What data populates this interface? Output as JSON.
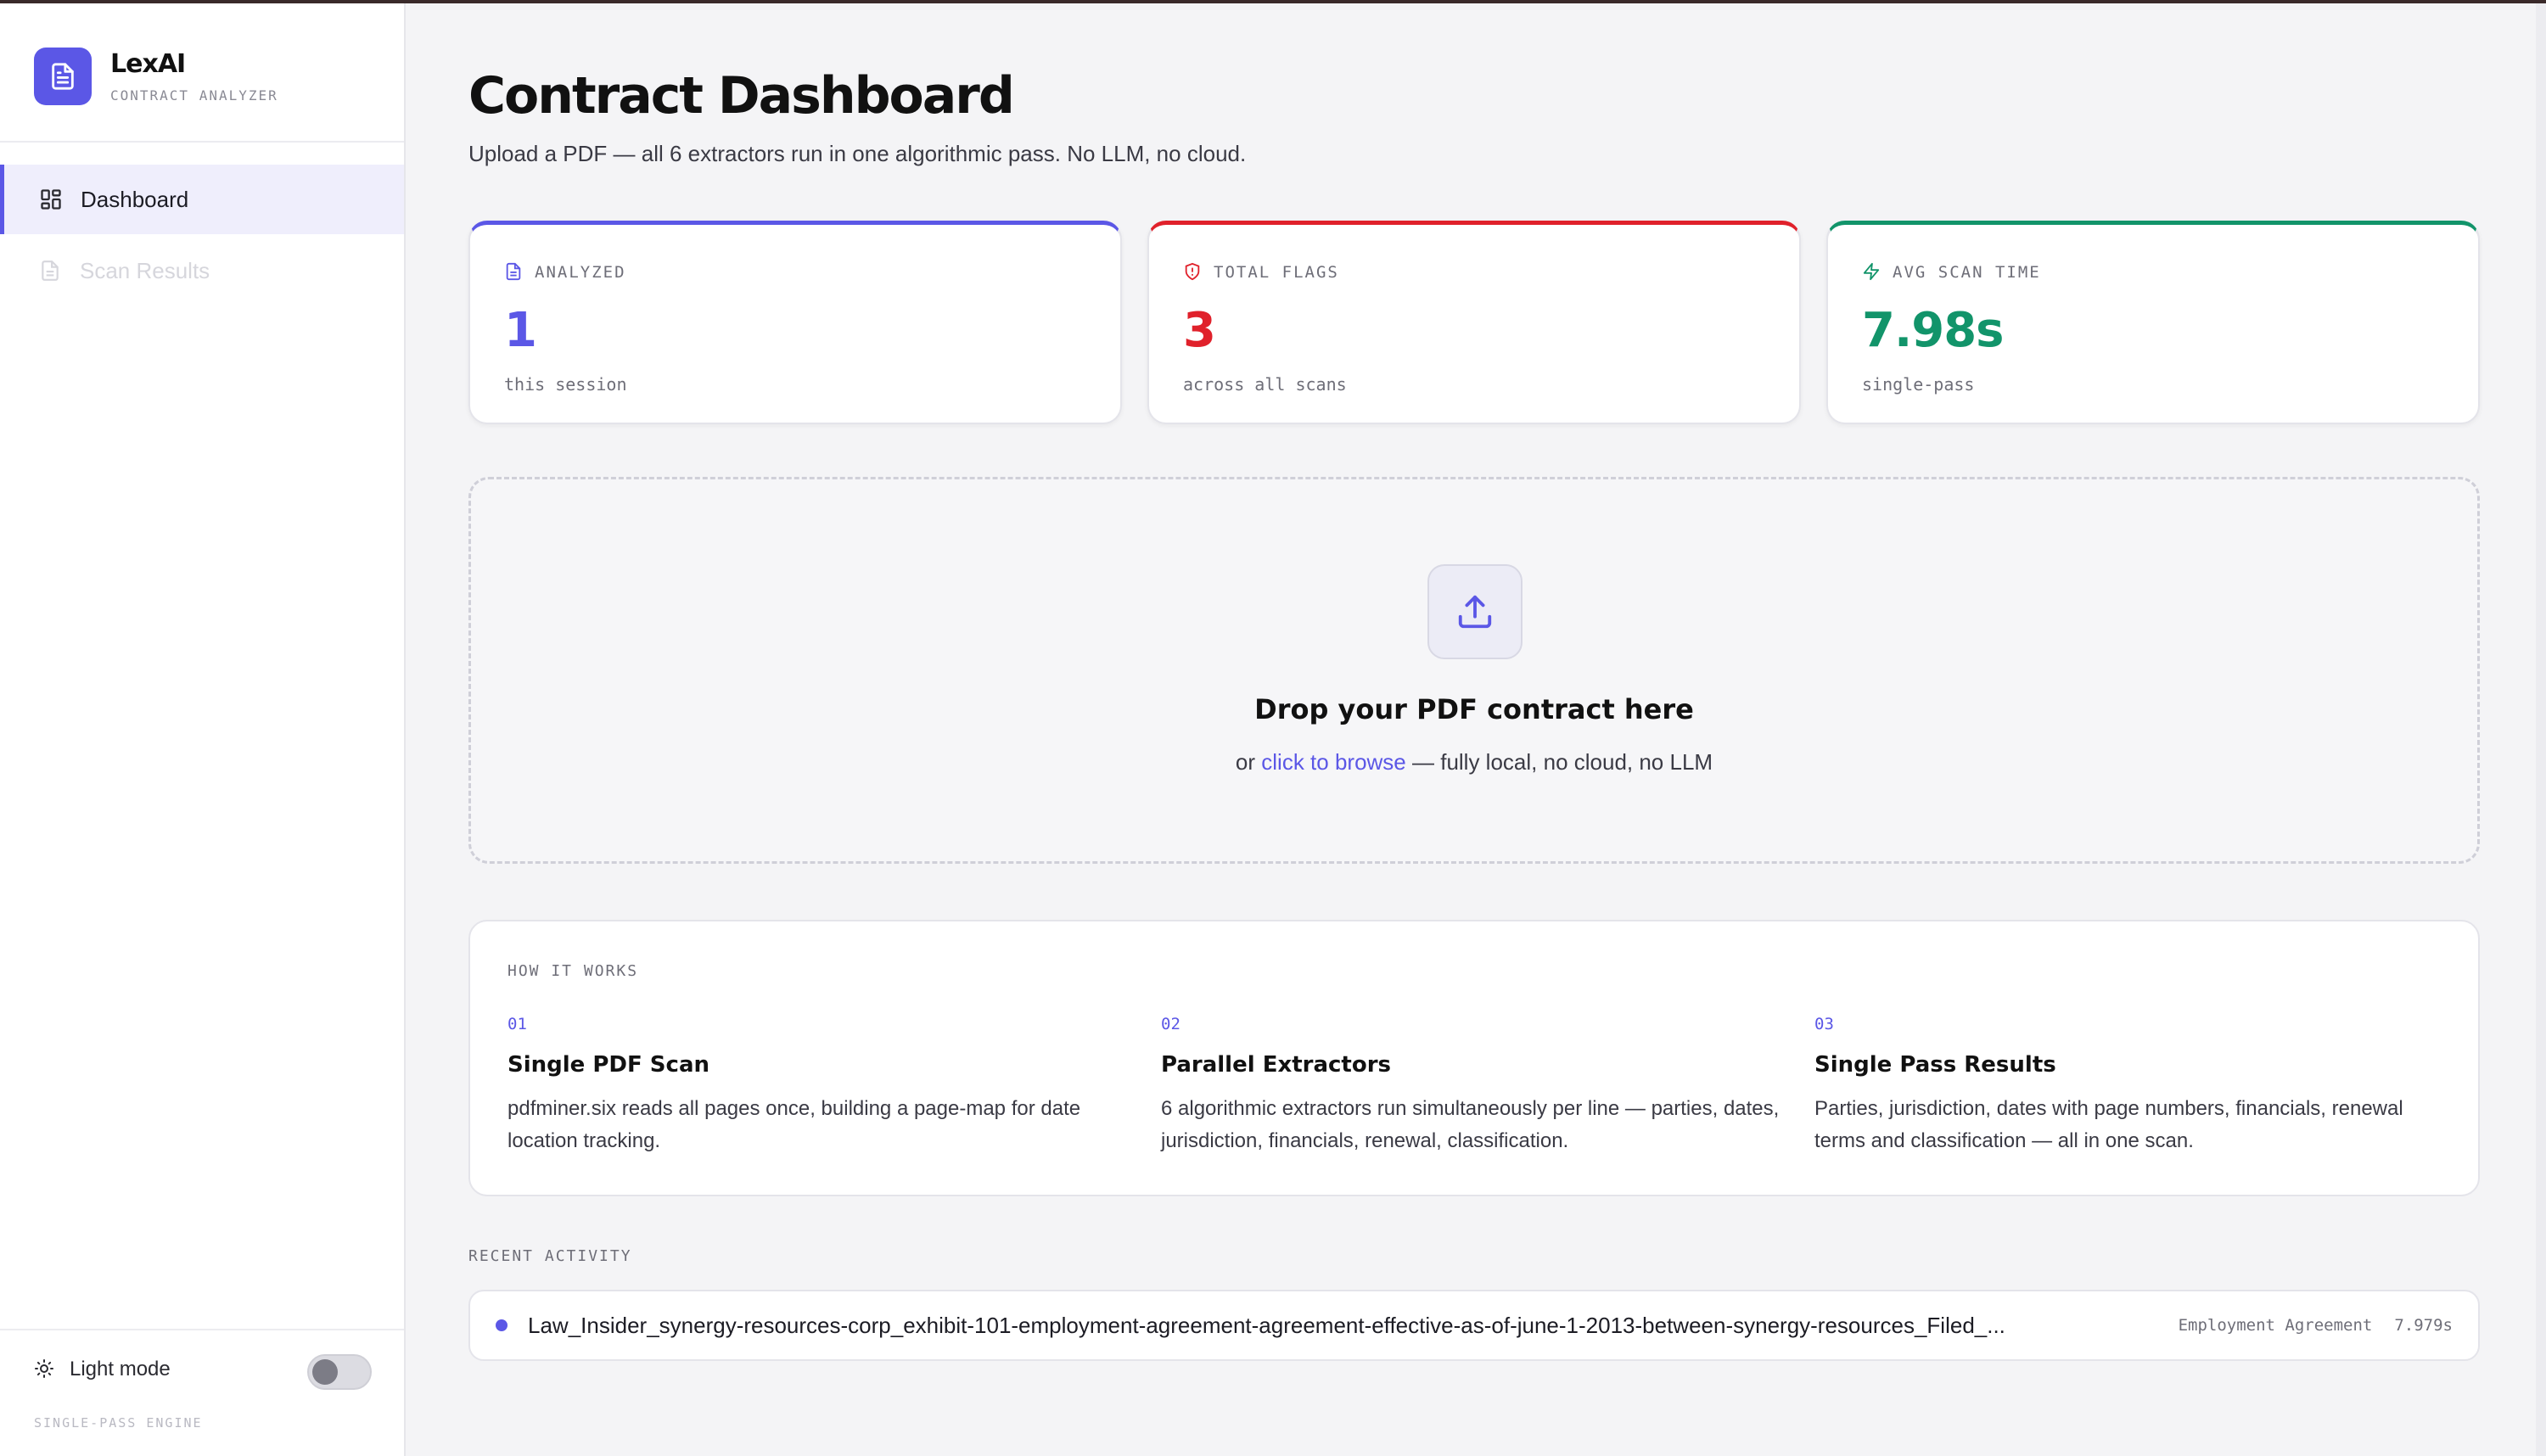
{
  "brand": {
    "name": "LexAI",
    "subtitle": "CONTRACT ANALYZER"
  },
  "sidebar": {
    "items": [
      {
        "label": "Dashboard",
        "icon": "grid-icon",
        "active": true
      },
      {
        "label": "Scan Results",
        "icon": "document-icon",
        "disabled": true
      }
    ],
    "theme_label": "Light mode",
    "theme_toggle_on": false,
    "engine_label": "SINGLE-PASS ENGINE"
  },
  "header": {
    "title": "Contract Dashboard",
    "subtitle": "Upload a PDF — all 6 extractors run in one algorithmic pass. No LLM, no cloud."
  },
  "stats": [
    {
      "label": "ANALYZED",
      "value": "1",
      "note": "this session",
      "icon": "document-icon",
      "color": "#5b57e6"
    },
    {
      "label": "TOTAL FLAGS",
      "value": "3",
      "note": "across all scans",
      "icon": "shield-alert-icon",
      "color": "#e0212b"
    },
    {
      "label": "AVG SCAN TIME",
      "value": "7.98s",
      "note": "single-pass",
      "icon": "lightning-icon",
      "color": "#12946a"
    }
  ],
  "dropzone": {
    "title": "Drop your PDF contract here",
    "prefix": "or",
    "link": "click to browse",
    "suffix": "— fully local, no cloud, no LLM"
  },
  "how_it_works": {
    "heading": "HOW IT WORKS",
    "steps": [
      {
        "num": "01",
        "title": "Single PDF Scan",
        "body": "pdfminer.six reads all pages once, building a page-map for date location tracking."
      },
      {
        "num": "02",
        "title": "Parallel Extractors",
        "body": "6 algorithmic extractors run simultaneously per line — parties, dates, jurisdiction, financials, renewal, classification."
      },
      {
        "num": "03",
        "title": "Single Pass Results",
        "body": "Parties, jurisdiction, dates with page numbers, financials, renewal terms and classification — all in one scan."
      }
    ]
  },
  "recent": {
    "heading": "RECENT ACTIVITY",
    "items": [
      {
        "file": "Law_Insider_synergy-resources-corp_exhibit-101-employment-agreement-agreement-effective-as-of-june-1-2013-between-synergy-resources_Filed_...",
        "type": "Employment Agreement",
        "time": "7.979s"
      }
    ]
  },
  "accent": "#5b57e6"
}
